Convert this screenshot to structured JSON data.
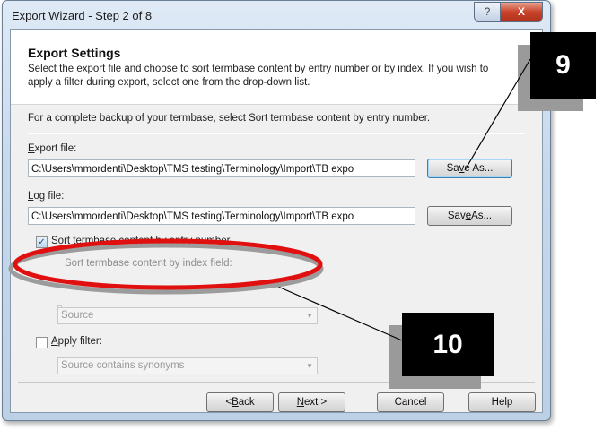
{
  "window": {
    "title": "Export Wizard - Step 2 of 8",
    "help_glyph": "?",
    "close_glyph": "X"
  },
  "header": {
    "title": "Export Settings",
    "description": "Select the export file and choose to sort termbase content by entry number or by index. If you wish to apply a filter during export, select one from the drop-down list."
  },
  "note": "For a complete backup of your termbase, select Sort termbase content by entry number.",
  "export_file": {
    "label_first": "E",
    "label_rest": "xport file:",
    "value": "C:\\Users\\mmordenti\\Desktop\\TMS testing\\Terminology\\Import\\TB expo",
    "button_pre": "Sa",
    "button_u": "v",
    "button_post": "e As..."
  },
  "log_file": {
    "label_first": "L",
    "label_rest": "og file:",
    "value": "C:\\Users\\mmordenti\\Desktop\\TMS testing\\Terminology\\Import\\TB expo",
    "button_pre": "Sav",
    "button_u": "e",
    "button_post": " As..."
  },
  "sort_by_entry": {
    "checked_glyph": "✓",
    "label_first": "S",
    "label_rest": "ort termbase content by entry number"
  },
  "sort_by_index": {
    "label": "Sort termbase content by index field:",
    "selected": "Source"
  },
  "apply_filter": {
    "label_first": "A",
    "label_rest": "pply filter:",
    "selected": "Source contains synonyms"
  },
  "buttons": {
    "back_pre": "< ",
    "back_u": "B",
    "back_post": "ack",
    "next_u": "N",
    "next_post": "ext >",
    "cancel": "Cancel",
    "help": "Help"
  },
  "callouts": {
    "first": "9",
    "second": "10"
  },
  "colors": {
    "highlight_ellipse": "#e01010",
    "callout_bg": "#000000"
  }
}
